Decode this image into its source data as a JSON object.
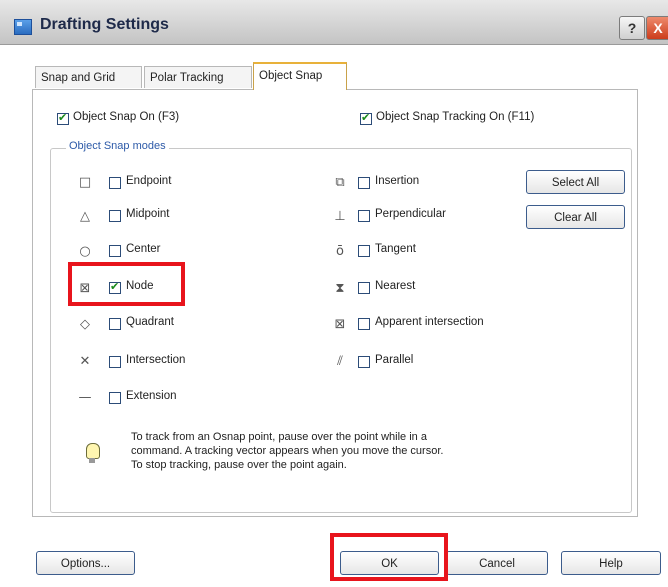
{
  "window": {
    "title": "Drafting Settings",
    "help_button": "?",
    "close_button": "X"
  },
  "tabs": [
    {
      "label": "Snap and Grid",
      "active": false
    },
    {
      "label": "Polar Tracking",
      "active": false
    },
    {
      "label": "Object Snap",
      "active": true
    }
  ],
  "top_options": {
    "object_snap_on": {
      "label": "Object Snap On (F3)",
      "checked": true
    },
    "tracking_on": {
      "label": "Object Snap Tracking On (F11)",
      "checked": true
    }
  },
  "group": {
    "title": "Object Snap modes",
    "left_modes": [
      {
        "label": "Endpoint",
        "checked": false,
        "icon": "endpoint-square-icon"
      },
      {
        "label": "Midpoint",
        "checked": false,
        "icon": "midpoint-triangle-icon"
      },
      {
        "label": "Center",
        "checked": false,
        "icon": "center-circle-icon"
      },
      {
        "label": "Node",
        "checked": true,
        "icon": "node-icon"
      },
      {
        "label": "Quadrant",
        "checked": false,
        "icon": "quadrant-diamond-icon"
      },
      {
        "label": "Intersection",
        "checked": false,
        "icon": "intersection-x-icon"
      },
      {
        "label": "Extension",
        "checked": false,
        "icon": "extension-dash-icon"
      }
    ],
    "right_modes": [
      {
        "label": "Insertion",
        "checked": false,
        "icon": "insertion-icon"
      },
      {
        "label": "Perpendicular",
        "checked": false,
        "icon": "perpendicular-icon"
      },
      {
        "label": "Tangent",
        "checked": false,
        "icon": "tangent-icon"
      },
      {
        "label": "Nearest",
        "checked": false,
        "icon": "nearest-hourglass-icon"
      },
      {
        "label": "Apparent intersection",
        "checked": false,
        "icon": "apparent-intersection-icon"
      },
      {
        "label": "Parallel",
        "checked": false,
        "icon": "parallel-icon"
      }
    ],
    "select_all": "Select All",
    "clear_all": "Clear All"
  },
  "note": {
    "line1": "To track from an Osnap point, pause over the point while in a",
    "line2": "command.  A tracking vector appears when you move the cursor.",
    "line3": "To stop tracking, pause over the point again."
  },
  "footer": {
    "options": "Options...",
    "ok": "OK",
    "cancel": "Cancel",
    "help": "Help"
  },
  "colors": {
    "highlight": "#e8141c",
    "group_title": "#2d5aa8",
    "active_tab_accent": "#e8b13a"
  }
}
